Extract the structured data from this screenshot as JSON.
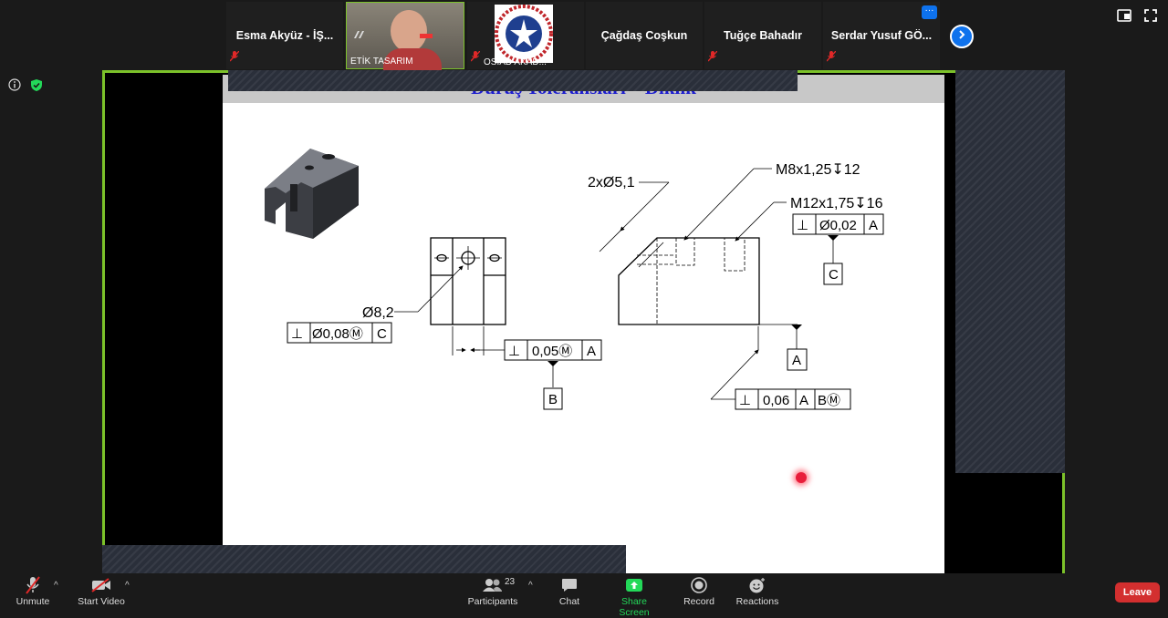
{
  "participants_strip": [
    {
      "name": "Esma Akyüz - İŞ...",
      "muted": true,
      "type": "name"
    },
    {
      "name": "ETİK TASARIM",
      "muted": false,
      "type": "video"
    },
    {
      "name": "OSİAD AKAD...",
      "muted": true,
      "type": "logo"
    },
    {
      "name": "Çağdaş Coşkun",
      "muted": false,
      "type": "name"
    },
    {
      "name": "Tuğçe Bahadır",
      "muted": true,
      "type": "name"
    },
    {
      "name": "Serdar Yusuf GÖ...",
      "muted": true,
      "type": "name"
    }
  ],
  "strip_more_label": "···",
  "slide": {
    "title": "Duruş Toleransları – Diklik",
    "labels": {
      "hole_note": "2xØ5,1",
      "thread_small": "M8x1,25↧12",
      "thread_large": "M12x1,75↧16",
      "dia_82": "Ø8,2",
      "fcf_left": [
        "⊥",
        "Ø0,08Ⓜ",
        "C"
      ],
      "fcf_mid": [
        "⊥",
        "0,05Ⓜ",
        "A"
      ],
      "fcf_right_top": [
        "⊥",
        "Ø0,02",
        "A"
      ],
      "fcf_right_bottom": [
        "⊥",
        "0,06",
        "A",
        "BⓂ"
      ],
      "datum_b": "B",
      "datum_c": "C",
      "datum_a": "A"
    }
  },
  "toolbar": {
    "unmute": "Unmute",
    "start_video": "Start Video",
    "participants": "Participants",
    "participants_count": "23",
    "chat": "Chat",
    "share_screen": "Share Screen",
    "record": "Record",
    "reactions": "Reactions",
    "leave": "Leave"
  },
  "colors": {
    "share_border": "#7cc22a",
    "accent_blue": "#0e72ed",
    "leave_red": "#d32f2f",
    "share_green": "#23d959",
    "slide_title": "#1c1ccf"
  }
}
